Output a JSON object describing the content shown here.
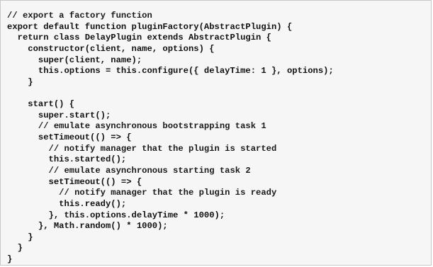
{
  "code": {
    "lines": [
      "// export a factory function",
      "export default function pluginFactory(AbstractPlugin) {",
      "  return class DelayPlugin extends AbstractPlugin {",
      "    constructor(client, name, options) {",
      "      super(client, name);",
      "      this.options = this.configure({ delayTime: 1 }, options);",
      "    }",
      "",
      "    start() {",
      "      super.start();",
      "      // emulate asynchronous bootstrapping task 1",
      "      setTimeout(() => {",
      "        // notify manager that the plugin is started",
      "        this.started();",
      "        // emulate asynchronous starting task 2",
      "        setTimeout(() => {",
      "          // notify manager that the plugin is ready",
      "          this.ready();",
      "        }, this.options.delayTime * 1000);",
      "      }, Math.random() * 1000);",
      "    }",
      "  }",
      "}"
    ]
  }
}
